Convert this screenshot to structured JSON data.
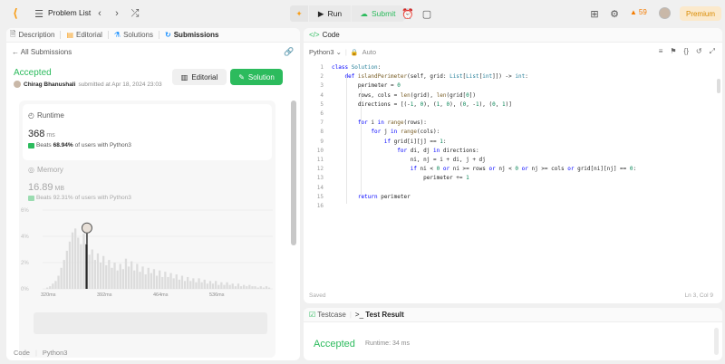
{
  "topbar": {
    "problem_list": "Problem List",
    "run": "Run",
    "submit": "Submit",
    "streak": "59",
    "premium": "Premium"
  },
  "left": {
    "tabs": [
      {
        "label": "Description"
      },
      {
        "label": "Editorial"
      },
      {
        "label": "Solutions"
      },
      {
        "label": "Submissions"
      }
    ],
    "all_submissions": "All Submissions",
    "status": "Accepted",
    "author": "Chirag Bhanushali",
    "submitted_text": "submitted at Apr 18, 2024 23:03",
    "editorial_btn": "Editorial",
    "solution_btn": "Solution",
    "runtime": {
      "label": "Runtime",
      "value": "368",
      "unit": "ms",
      "beats_prefix": "Beats",
      "beats_pct": "68.94%",
      "beats_suffix": "of users with Python3"
    },
    "memory": {
      "label": "Memory",
      "value": "16.89",
      "unit": "MB",
      "beats_prefix": "Beats",
      "beats_pct": "92.31%",
      "beats_suffix": "of users with Python3"
    },
    "footer_code": "Code",
    "footer_lang": "Python3"
  },
  "chart_data": {
    "type": "bar",
    "y_ticks": [
      "6%",
      "4%",
      "2%",
      "0%"
    ],
    "ylim": [
      0,
      6
    ],
    "x_ticks": [
      "320ms",
      "392ms",
      "464ms",
      "536ms"
    ],
    "mini_x_ticks": [
      "320ms",
      "392ms",
      "464ms",
      "536ms"
    ],
    "highlight_index": 14,
    "values": [
      0.1,
      0.2,
      0.4,
      0.6,
      1.0,
      1.6,
      2.2,
      2.9,
      3.6,
      4.3,
      4.6,
      3.9,
      3.4,
      4.2,
      3.4,
      2.6,
      3.0,
      2.2,
      2.7,
      2.0,
      2.5,
      1.8,
      2.2,
      1.6,
      2.0,
      1.4,
      1.9,
      1.5,
      2.3,
      1.7,
      2.1,
      1.4,
      1.9,
      1.3,
      1.7,
      1.1,
      1.6,
      1.2,
      1.5,
      1.0,
      1.4,
      0.9,
      1.3,
      0.9,
      1.2,
      0.8,
      1.1,
      0.7,
      1.0,
      0.6,
      0.9,
      0.6,
      0.8,
      0.5,
      0.8,
      0.5,
      0.7,
      0.4,
      0.6,
      0.4,
      0.6,
      0.3,
      0.5,
      0.3,
      0.5,
      0.3,
      0.4,
      0.2,
      0.4,
      0.2,
      0.3,
      0.2,
      0.3,
      0.2,
      0.2,
      0.1,
      0.2,
      0.1,
      0.2,
      0.1
    ]
  },
  "editor": {
    "section": "Code",
    "language": "Python3",
    "mode": "Auto",
    "saved": "Saved",
    "cursor": "Ln 3, Col 9",
    "lines": [
      "class Solution:",
      "    def islandPerimeter(self, grid: List[List[int]]) -> int:",
      "        perimeter = 0",
      "        rows, cols = len(grid), len(grid[0])",
      "        directions = [(-1, 0), (1, 0), (0, -1), (0, 1)]",
      "",
      "        for i in range(rows):",
      "            for j in range(cols):",
      "                if grid[i][j] == 1:",
      "                    for di, dj in directions:",
      "                        ni, nj = i + di, j + dj",
      "                        if ni < 0 or ni >= rows or nj < 0 or nj >= cols or grid[ni][nj] == 0:",
      "                            perimeter += 1",
      "",
      "        return perimeter",
      ""
    ]
  },
  "bottom": {
    "tab_testcase": "Testcase",
    "tab_result": "Test Result",
    "status": "Accepted",
    "runtime": "Runtime: 34 ms"
  }
}
